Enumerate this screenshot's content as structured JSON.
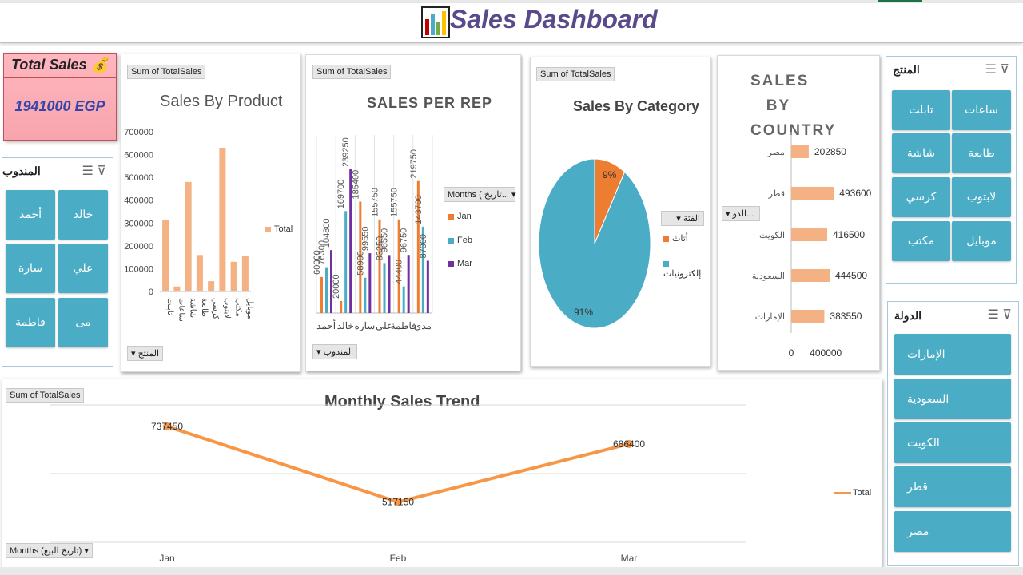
{
  "dashboard": {
    "title": "Sales Dashboard"
  },
  "kpi": {
    "title": "Total Sales 💰",
    "value": "1941000 EGP"
  },
  "rep_slicer": {
    "title": "المندوب",
    "items": [
      "خالد",
      "أحمد",
      "علي",
      "سارة",
      "مى",
      "فاطمة"
    ]
  },
  "product_slicer": {
    "title": "المنتج",
    "items": [
      "ساعات",
      "تابلت",
      "طابعة",
      "شاشة",
      "لابتوب",
      "كرسي",
      "موبايل",
      "مكتب"
    ]
  },
  "country_slicer": {
    "title": "الدولة",
    "items": [
      "الإمارات",
      "السعودية",
      "الكويت",
      "قطر",
      "مصر"
    ]
  },
  "sales_by_product": {
    "field_button": "Sum of TotalSales",
    "filter_button": "المنتج",
    "legend": "Total",
    "color": "#f4b183",
    "y_ticks": [
      "0",
      "100000",
      "200000",
      "300000",
      "400000",
      "500000",
      "600000",
      "700000"
    ]
  },
  "sales_per_rep": {
    "field_button": "Sum of TotalSales",
    "filter_button": "المندوب",
    "legend_button": "Months ( تاريخ...",
    "colors": {
      "Jan": "#ed7d31",
      "Feb": "#4bacc6",
      "Mar": "#7030a0"
    }
  },
  "sales_by_category": {
    "field_button": "Sum of TotalSales",
    "legend_button": "الفئة",
    "colors": {
      "أثاث": "#ed7d31",
      "إلكترونيات": "#4bacc6"
    }
  },
  "sales_by_country": {
    "filter_button": "الدو...",
    "color": "#f4b183",
    "x_ticks": [
      "0",
      "400000"
    ]
  },
  "monthly_trend": {
    "field_button": "Sum of TotalSales",
    "axis_button": "Months (تاريخ البيع)",
    "legend": "Total",
    "color": "#f79646"
  },
  "chart_data": [
    {
      "type": "bar",
      "title": "Sales By Product",
      "categories": [
        "تابلت",
        "ساعات",
        "شاشة",
        "طابعة",
        "كرسي",
        "لابتوب",
        "مكتب",
        "موبايل"
      ],
      "series": [
        {
          "name": "Total",
          "values": [
            315000,
            22000,
            480000,
            160000,
            45000,
            630000,
            130000,
            155000
          ]
        }
      ],
      "ylim": [
        0,
        700000
      ]
    },
    {
      "type": "bar",
      "title": "SALES PER REP",
      "categories": [
        "أحمد",
        "خالد",
        "ساره",
        "علي",
        "فاطمة",
        "مدى"
      ],
      "series": [
        {
          "name": "Jan",
          "values": [
            60000,
            20000,
            185400,
            155750,
            155750,
            219750
          ]
        },
        {
          "name": "Feb",
          "values": [
            76300,
            169700,
            58900,
            83250,
            44400,
            143700
          ]
        },
        {
          "name": "Mar",
          "values": [
            104800,
            239250,
            99550,
            96550,
            96750,
            87000
          ]
        }
      ],
      "labels": [
        "60000",
        "104800",
        "76300",
        "20000",
        "169700",
        "239250",
        "185400",
        "58900",
        "99550",
        "96550",
        "155750",
        "83250",
        "96750",
        "44400",
        "219750",
        "87000",
        "143700"
      ]
    },
    {
      "type": "pie",
      "title": "Sales By Category",
      "categories": [
        "أثاث",
        "إلكترونيات"
      ],
      "values": [
        9,
        91
      ],
      "labels": [
        "9%",
        "91%"
      ]
    },
    {
      "type": "bar",
      "title": "SALES BY COUNTRY",
      "categories": [
        "مصر",
        "قطر",
        "الكويت",
        "السعودية",
        "الإمارات"
      ],
      "values": [
        202850,
        493600,
        416500,
        444500,
        383550
      ],
      "labels": [
        "202850",
        "493600",
        "416500",
        "444500",
        "383550"
      ],
      "xlim": [
        0,
        1000000
      ]
    },
    {
      "type": "line",
      "title": "Monthly Sales Trend",
      "categories": [
        "Jan",
        "Feb",
        "Mar"
      ],
      "series": [
        {
          "name": "Total",
          "values": [
            737450,
            517150,
            686400
          ]
        }
      ],
      "labels": [
        "737450",
        "517150",
        "686400"
      ]
    }
  ]
}
